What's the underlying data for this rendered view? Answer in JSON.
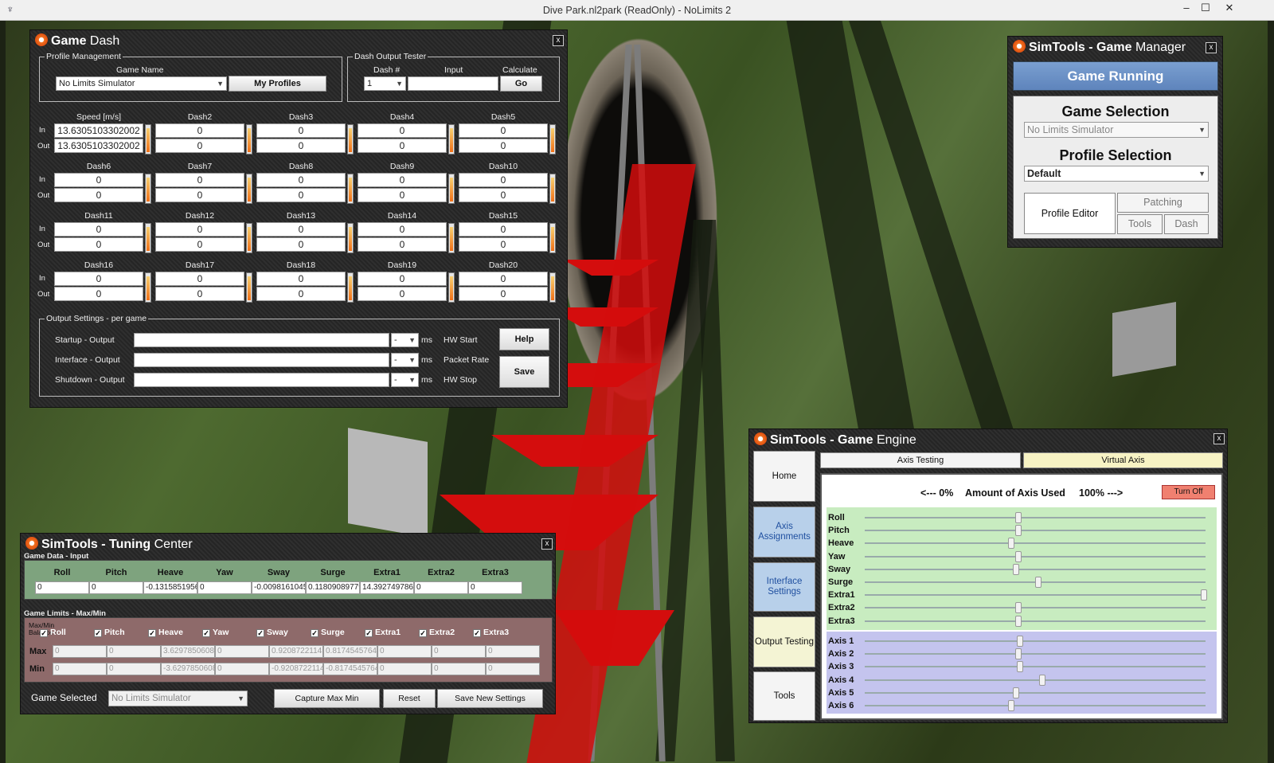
{
  "window": {
    "title": "Dive Park.nl2park (ReadOnly) - NoLimits 2",
    "minimize": "–",
    "maximize": "☐",
    "close": "✕"
  },
  "game_dash": {
    "title_bold": "Game",
    "title_rest": "Dash",
    "close": "x",
    "profile_group": "Profile Management",
    "game_name_label": "Game Name",
    "game_name_value": "No Limits Simulator",
    "my_profiles": "My Profiles",
    "tester_group": "Dash Output Tester",
    "dash_num_label": "Dash #",
    "dash_num_value": "1",
    "input_label": "Input",
    "input_value": "",
    "calculate_label": "Calculate",
    "go": "Go",
    "in_label": "In",
    "out_label": "Out",
    "dashes": [
      {
        "name": "Speed [m/s]",
        "in": "13.6305103302002",
        "out": "13.6305103302002"
      },
      {
        "name": "Dash2",
        "in": "0",
        "out": "0"
      },
      {
        "name": "Dash3",
        "in": "0",
        "out": "0"
      },
      {
        "name": "Dash4",
        "in": "0",
        "out": "0"
      },
      {
        "name": "Dash5",
        "in": "0",
        "out": "0"
      },
      {
        "name": "Dash6",
        "in": "0",
        "out": "0"
      },
      {
        "name": "Dash7",
        "in": "0",
        "out": "0"
      },
      {
        "name": "Dash8",
        "in": "0",
        "out": "0"
      },
      {
        "name": "Dash9",
        "in": "0",
        "out": "0"
      },
      {
        "name": "Dash10",
        "in": "0",
        "out": "0"
      },
      {
        "name": "Dash11",
        "in": "0",
        "out": "0"
      },
      {
        "name": "Dash12",
        "in": "0",
        "out": "0"
      },
      {
        "name": "Dash13",
        "in": "0",
        "out": "0"
      },
      {
        "name": "Dash14",
        "in": "0",
        "out": "0"
      },
      {
        "name": "Dash15",
        "in": "0",
        "out": "0"
      },
      {
        "name": "Dash16",
        "in": "0",
        "out": "0"
      },
      {
        "name": "Dash17",
        "in": "0",
        "out": "0"
      },
      {
        "name": "Dash18",
        "in": "0",
        "out": "0"
      },
      {
        "name": "Dash19",
        "in": "0",
        "out": "0"
      },
      {
        "name": "Dash20",
        "in": "0",
        "out": "0"
      }
    ],
    "output_group": "Output Settings - per game",
    "outputs": [
      {
        "label": "Startup - Output",
        "combo": "-",
        "unit": "ms",
        "right": "HW Start"
      },
      {
        "label": "Interface - Output",
        "combo": "-",
        "unit": "ms",
        "right": "Packet Rate"
      },
      {
        "label": "Shutdown - Output",
        "combo": "-",
        "unit": "ms",
        "right": "HW Stop"
      }
    ],
    "help": "Help",
    "save": "Save"
  },
  "game_manager": {
    "title_a": "SimTools - ",
    "title_b": "Game",
    "title_c": " Manager",
    "close": "x",
    "status": "Game Running",
    "game_selection_label": "Game Selection",
    "game_selection_value": "No Limits Simulator",
    "profile_selection_label": "Profile Selection",
    "profile_selection_value": "Default",
    "profile_editor": "Profile Editor",
    "patching": "Patching",
    "tools": "Tools",
    "dash": "Dash"
  },
  "tuning_center": {
    "title_a": "SimTools - ",
    "title_b": "Tuning",
    "title_c": " Center",
    "close": "x",
    "input_section": "Game Data - Input",
    "axes": [
      "Roll",
      "Pitch",
      "Heave",
      "Yaw",
      "Sway",
      "Surge",
      "Extra1",
      "Extra2",
      "Extra3"
    ],
    "inputs": [
      "0",
      "0",
      "-0.13158519566",
      "0",
      "-0.00981610454",
      "0.11809089779",
      "14.3927497863",
      "0",
      "0"
    ],
    "limits_section": "Game Limits - Max/Min",
    "balance_label_1": "Max/Min",
    "balance_label_2": "Balance -",
    "check_mark": "✓",
    "max_label": "Max",
    "min_label": "Min",
    "max": [
      "0",
      "0",
      "3.62978506088",
      "0",
      "0.92087221145",
      "0.81745457645",
      "0",
      "0",
      "0"
    ],
    "min": [
      "0",
      "0",
      "-3.6297850608",
      "0",
      "-0.9208722114",
      "-0.8174545764",
      "0",
      "0",
      "0"
    ],
    "game_selected_label": "Game Selected",
    "game_selected_value": "No Limits Simulator",
    "capture": "Capture Max Min",
    "reset": "Reset",
    "save_new": "Save New Settings"
  },
  "game_engine": {
    "title_a": "SimTools - ",
    "title_b": "Game",
    "title_c": " Engine",
    "close": "x",
    "nav": [
      "Home",
      "Axis Assignments",
      "Interface Settings",
      "Output Testing",
      "Tools"
    ],
    "tab_axis_testing": "Axis Testing",
    "tab_virtual_axis": "Virtual Axis",
    "amount_left": "<--- 0%",
    "amount_mid": "Amount of Axis Used",
    "amount_right": "100% --->",
    "turn_off": "Turn Off",
    "game_axes": [
      {
        "name": "Roll",
        "value": 0.45
      },
      {
        "name": "Pitch",
        "value": 0.45
      },
      {
        "name": "Heave",
        "value": 0.43
      },
      {
        "name": "Yaw",
        "value": 0.45
      },
      {
        "name": "Sway",
        "value": 0.445
      },
      {
        "name": "Surge",
        "value": 0.51
      },
      {
        "name": "Extra1",
        "value": 0.995
      },
      {
        "name": "Extra2",
        "value": 0.45
      },
      {
        "name": "Extra3",
        "value": 0.45
      }
    ],
    "virtual_axes": [
      {
        "name": "Axis 1",
        "value": 0.455
      },
      {
        "name": "Axis 2",
        "value": 0.45
      },
      {
        "name": "Axis 3",
        "value": 0.455
      },
      {
        "name": "Axis 4",
        "value": 0.52
      },
      {
        "name": "Axis 5",
        "value": 0.445
      },
      {
        "name": "Axis 6",
        "value": 0.43
      }
    ]
  }
}
